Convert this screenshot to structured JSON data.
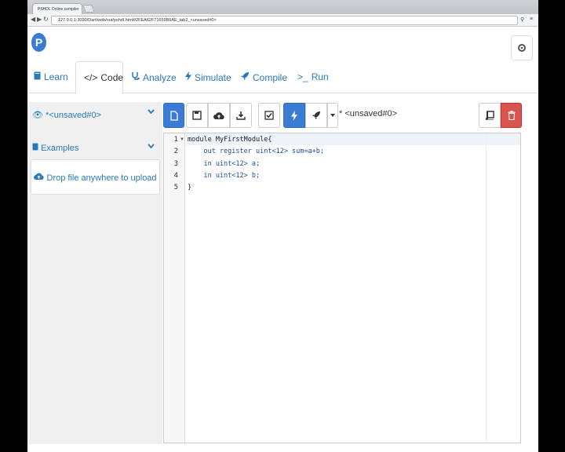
{
  "browser": {
    "tab_title": "PSHDL Online compiler",
    "url": "127.0.0.1:3030/Dart/web/out/pshdl.html#2FEA62F71659B9AE_tab2_<unsaved#0>"
  },
  "app": {
    "logo_letter": "P",
    "nav_tabs": [
      {
        "label": "Learn",
        "icon": "book-icon"
      },
      {
        "label": "Code",
        "icon": "code-icon"
      },
      {
        "label": "Analyze",
        "icon": "stethoscope-icon"
      },
      {
        "label": "Simulate",
        "icon": "bolt-icon"
      },
      {
        "label": "Compile",
        "icon": "rocket-icon"
      },
      {
        "label": "Run",
        "icon": "terminal-icon"
      }
    ],
    "active_tab": "Code"
  },
  "sidebar": {
    "file_name": "*<unsaved#0>",
    "examples_label": "Examples",
    "drop_label": "Drop file anywhere to upload"
  },
  "toolbar": {
    "file_label": "* <unsaved#0>",
    "accent_color": "#3a7bd5",
    "danger_color": "#d9534f"
  },
  "editor": {
    "line_numbers": [
      "1",
      "2",
      "3",
      "4",
      "5"
    ],
    "lines": [
      "module MyFirstModule{",
      "    out register uint<12> sum=a+b;",
      "    in uint<12> a;",
      "    in uint<12> b;",
      "}"
    ]
  }
}
